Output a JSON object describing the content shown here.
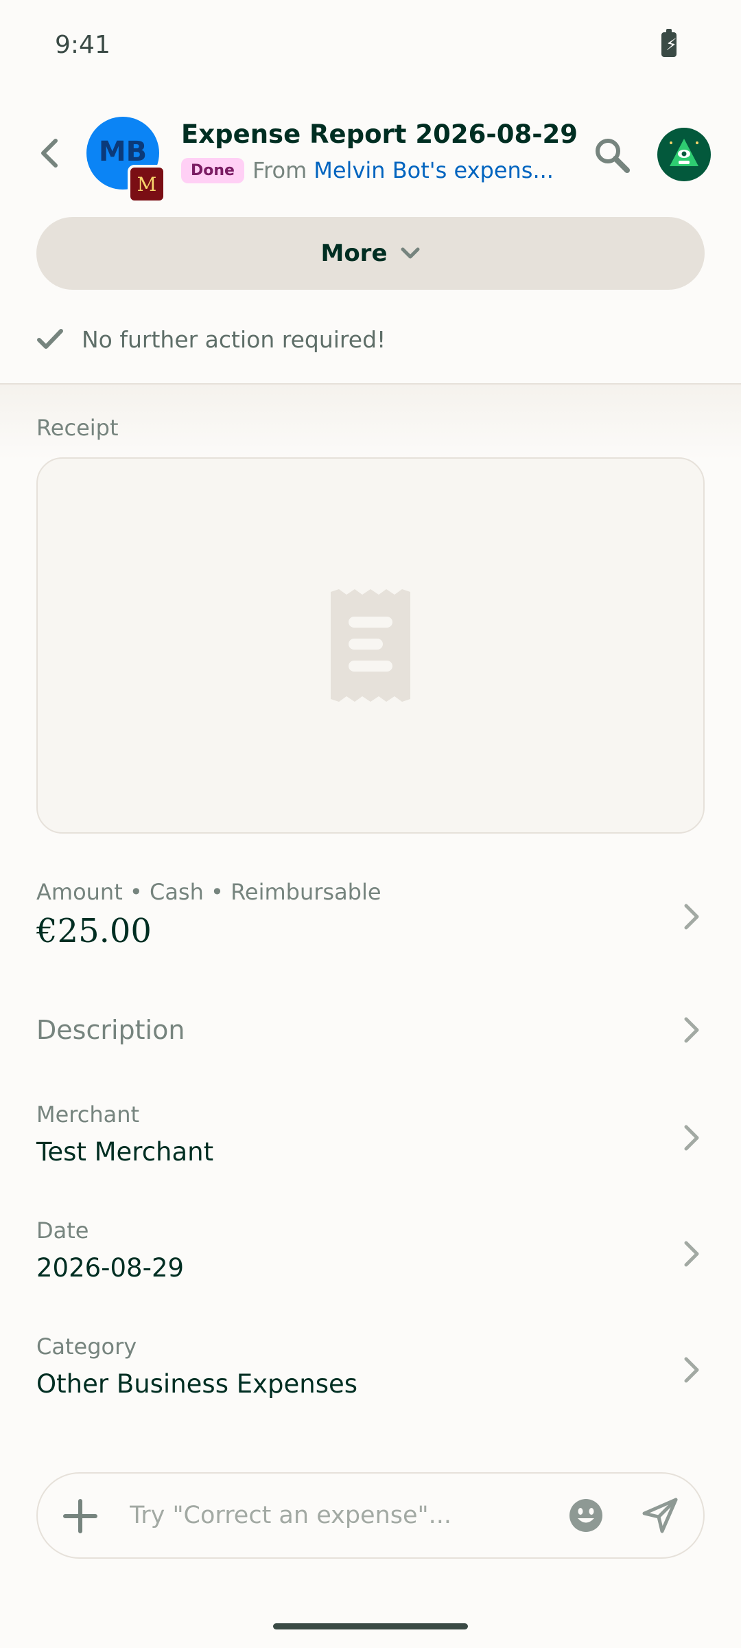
{
  "status_bar": {
    "time": "9:41"
  },
  "header": {
    "avatar_initials": "MB",
    "workspace_initial": "M",
    "title": "Expense Report 2026-08-29",
    "status_badge": "Done",
    "from_label": "From",
    "from_link": "Melvin Bot's expens..."
  },
  "more_button": {
    "label": "More"
  },
  "notice": {
    "text": "No further action required!"
  },
  "receipt": {
    "label": "Receipt"
  },
  "fields": {
    "amount": {
      "label": "Amount • Cash • Reimbursable",
      "value": "€25.00"
    },
    "description": {
      "label": "Description"
    },
    "merchant": {
      "label": "Merchant",
      "value": "Test Merchant"
    },
    "date": {
      "label": "Date",
      "value": "2026-08-29"
    },
    "category": {
      "label": "Category",
      "value": "Other Business Expenses"
    }
  },
  "composer": {
    "placeholder": "Try \"Correct an expense\"..."
  },
  "colors": {
    "background": "#FCFBF9",
    "text_primary": "#002E22",
    "text_muted": "#76847E",
    "link": "#0164BF",
    "button_bg": "#E6E1DA",
    "badge_bg": "#FFD0F5",
    "avatar_blue": "#0B84F5",
    "user_avatar_green": "#03593C"
  }
}
